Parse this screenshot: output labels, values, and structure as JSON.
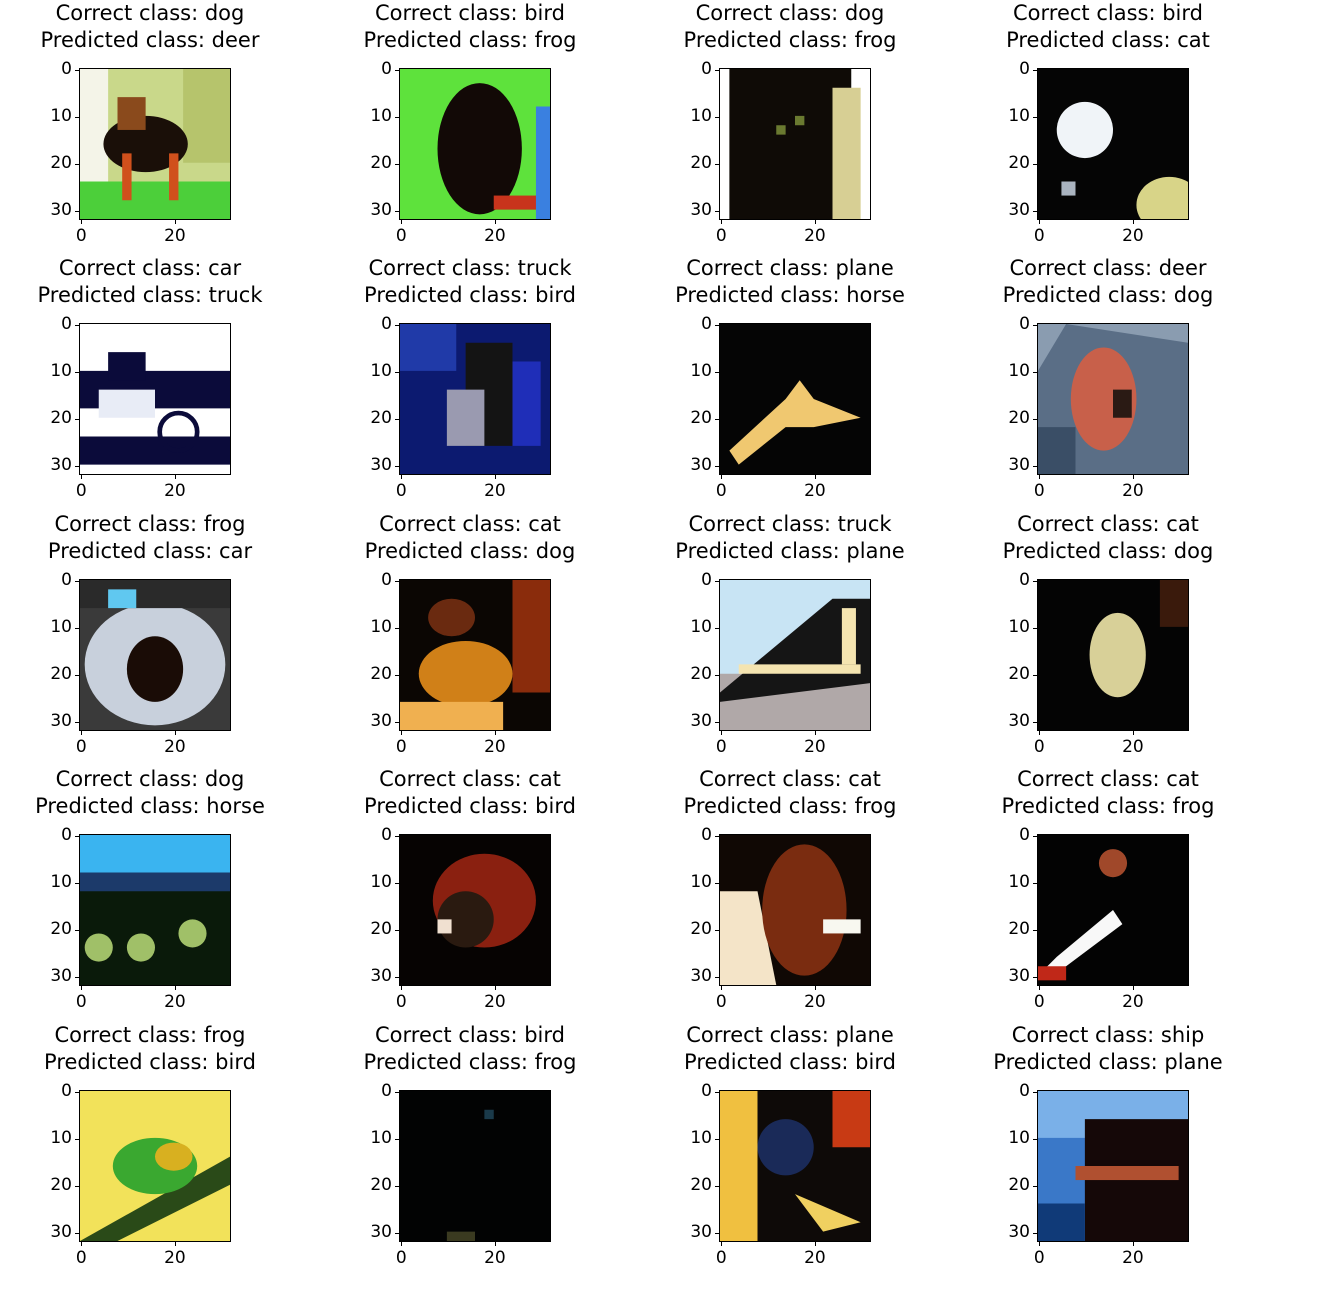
{
  "axes": {
    "xticks": [
      "0",
      "20"
    ],
    "yticks": [
      "0",
      "10",
      "20",
      "30"
    ]
  },
  "panels": [
    {
      "correct": "Correct class: dog",
      "predicted": "Predicted class: deer",
      "scene": "dog"
    },
    {
      "correct": "Correct class: bird",
      "predicted": "Predicted class: frog",
      "scene": "bird-green"
    },
    {
      "correct": "Correct class: dog",
      "predicted": "Predicted class: frog",
      "scene": "dog-dark"
    },
    {
      "correct": "Correct class: bird",
      "predicted": "Predicted class: cat",
      "scene": "bird-white"
    },
    {
      "correct": "Correct class: car",
      "predicted": "Predicted class: truck",
      "scene": "car"
    },
    {
      "correct": "Correct class: truck",
      "predicted": "Predicted class: bird",
      "scene": "truck-blue"
    },
    {
      "correct": "Correct class: plane",
      "predicted": "Predicted class: horse",
      "scene": "plane"
    },
    {
      "correct": "Correct class: deer",
      "predicted": "Predicted class: dog",
      "scene": "deer"
    },
    {
      "correct": "Correct class: frog",
      "predicted": "Predicted class: car",
      "scene": "frog-grey"
    },
    {
      "correct": "Correct class: cat",
      "predicted": "Predicted class: dog",
      "scene": "cat-orange"
    },
    {
      "correct": "Correct class: truck",
      "predicted": "Predicted class: plane",
      "scene": "truck-stripes"
    },
    {
      "correct": "Correct class: cat",
      "predicted": "Predicted class: dog",
      "scene": "cat-dark"
    },
    {
      "correct": "Correct class: dog",
      "predicted": "Predicted class: horse",
      "scene": "dog-sky"
    },
    {
      "correct": "Correct class: cat",
      "predicted": "Predicted class: bird",
      "scene": "cat-red"
    },
    {
      "correct": "Correct class: cat",
      "predicted": "Predicted class: frog",
      "scene": "cat-brown"
    },
    {
      "correct": "Correct class: cat",
      "predicted": "Predicted class: frog",
      "scene": "cat-black"
    },
    {
      "correct": "Correct class: frog",
      "predicted": "Predicted class: bird",
      "scene": "frog-yellow"
    },
    {
      "correct": "Correct class: bird",
      "predicted": "Predicted class: frog",
      "scene": "dark"
    },
    {
      "correct": "Correct class: plane",
      "predicted": "Predicted class: bird",
      "scene": "plane-dark"
    },
    {
      "correct": "Correct class: ship",
      "predicted": "Predicted class: plane",
      "scene": "ship"
    }
  ]
}
